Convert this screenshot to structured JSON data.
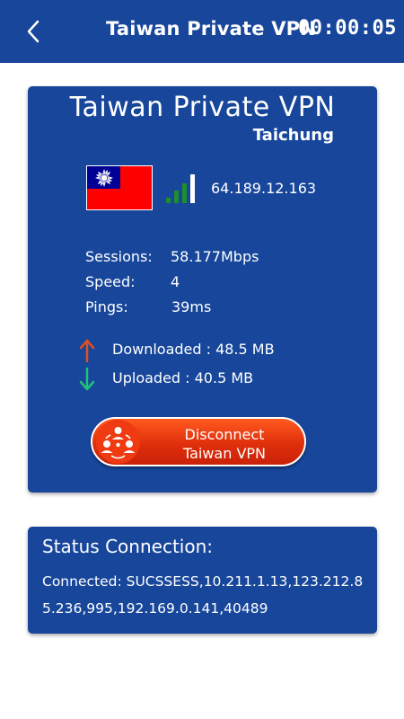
{
  "appbar": {
    "back_icon": "chevron-left-icon",
    "title": "Taiwan Private VPN",
    "timer": "00:00:05"
  },
  "server": {
    "name": "Taiwan Private VPN",
    "city": "Taichung",
    "flag": "taiwan-flag",
    "ip": "64.189.12.163",
    "signal_bars": 4,
    "signal_color": "#1f8f2a"
  },
  "stats": {
    "sessions_label": "Sessions:",
    "sessions_value": "58.177Mbps",
    "speed_label": "Speed:",
    "speed_value": "4",
    "pings_label": "Pings:",
    "pings_value": "39ms"
  },
  "transfer": {
    "downloaded": "Downloaded : 48.5 MB",
    "uploaded": "Uploaded : 40.5 MB",
    "download_arrow_color": "#e0501f",
    "upload_arrow_color": "#22c27a"
  },
  "disconnect_button": {
    "line1": "Disconnect",
    "line2": "Taiwan VPN",
    "icon": "network-users-icon",
    "color": "#e2300c"
  },
  "status": {
    "title": "Status Connection:",
    "text": "Connected: SUCSSESS,10.211.1.13,123.212.85.236,995,192.169.0.141,40489"
  },
  "colors": {
    "primary": "#17469b",
    "background": "#ffffff"
  }
}
